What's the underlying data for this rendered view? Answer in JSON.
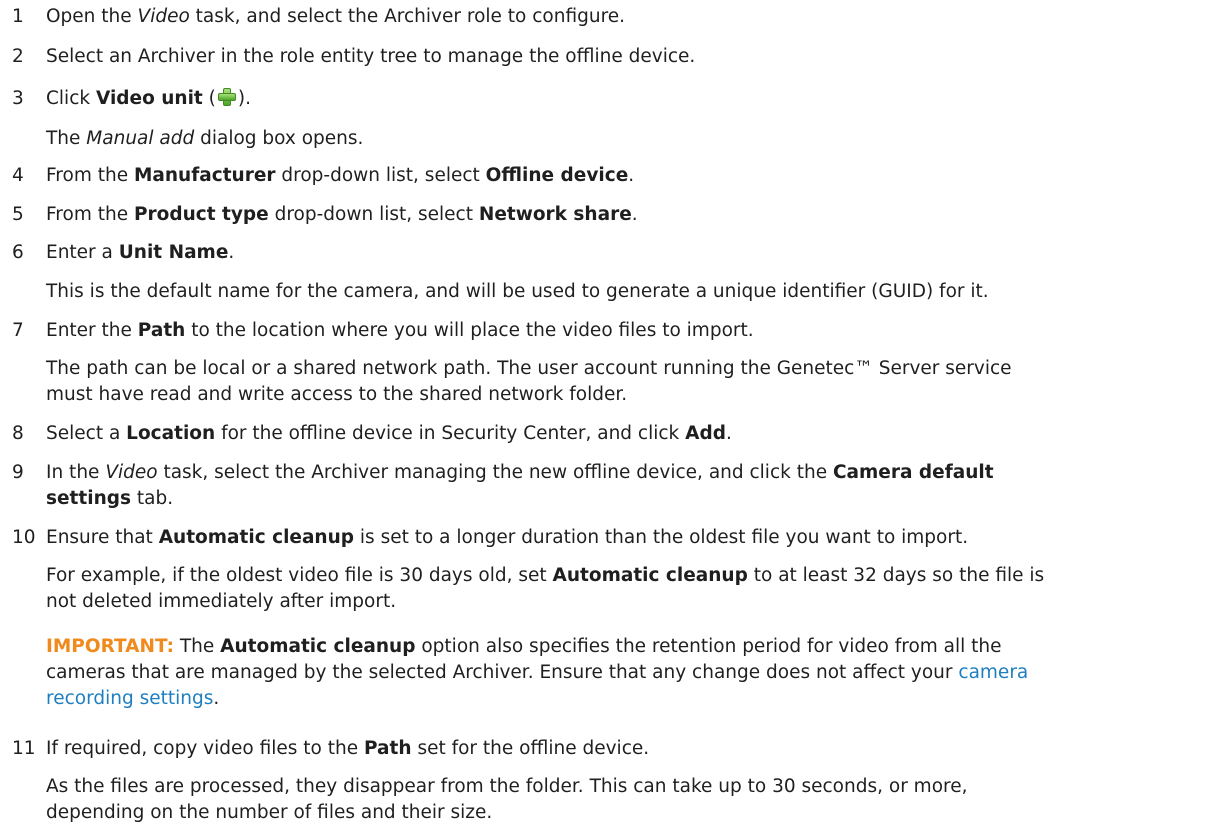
{
  "steps": [
    {
      "num": "1",
      "pre": "Open the ",
      "em": "Video",
      "post": " task, and select the Archiver role to configure."
    },
    {
      "num": "2",
      "text": "Select an Archiver in the role entity tree to manage the offline device."
    },
    {
      "num": "3",
      "pre": "Click ",
      "bold": "Video unit",
      "paren_open": " (",
      "paren_close": ").",
      "result_em": "Manual add",
      "result_post": " dialog box opens.",
      "result_pre": "The "
    },
    {
      "num": "4",
      "a": "From the ",
      "b1": "Manufacturer",
      "c": " drop-down list, select ",
      "b2": "Offline device",
      "d": "."
    },
    {
      "num": "5",
      "a": "From the ",
      "b1": "Product type",
      "c": " drop-down list, select ",
      "b2": "Network share",
      "d": "."
    },
    {
      "num": "6",
      "a": "Enter a ",
      "b1": "Unit Name",
      "d": ".",
      "result": "This is the default name for the camera, and will be used to generate a unique identifier (GUID) for it."
    },
    {
      "num": "7",
      "a": "Enter the ",
      "b1": "Path",
      "c": " to the location where you will place the video files to import.",
      "result1": "The path can be local or a shared network path. The user account running the Genetec™ Server service",
      "result2": "must have read and write access to the shared network folder."
    },
    {
      "num": "8",
      "a": "Select a ",
      "b1": "Location",
      "c": " for the offline device in Security Center, and click ",
      "b2": "Add",
      "d": "."
    },
    {
      "num": "9",
      "a": "In the ",
      "em": "Video",
      "c": " task, select the Archiver managing the new offline device, and click the ",
      "b1": "Camera default",
      "b2": "settings",
      "d": " tab."
    },
    {
      "num": "10",
      "a": "Ensure that ",
      "b1": "Automatic cleanup",
      "c": " is set to a longer duration than the oldest file you want to import.",
      "r1a": "For example, if the oldest video file is 30 days old, set ",
      "r1b": "Automatic cleanup",
      "r1c": " to at least 32 days so the file is",
      "r2": "not deleted immediately after import.",
      "imp_label": "IMPORTANT:",
      "imp_a": " The ",
      "imp_b": "Automatic cleanup",
      "imp_c": " option also specifies the retention period for video from all the",
      "imp_line2": "cameras that are managed by the selected Archiver. Ensure that any change does not affect your ",
      "imp_link1": "camera",
      "imp_link2": "recording settings",
      "imp_end": "."
    },
    {
      "num": "11",
      "a": "If required, copy video files to the ",
      "b1": "Path",
      "c": " set for the offline device.",
      "result1": "As the files are processed, they disappear from the folder. This can take up to 30 seconds, or more,",
      "result2": "depending on the number of files and their size."
    }
  ],
  "colors": {
    "important": "#f08a1c",
    "link": "#1d7fc1",
    "text": "#1f1f1f"
  },
  "icons": {
    "video_unit": "green-plus-icon"
  }
}
